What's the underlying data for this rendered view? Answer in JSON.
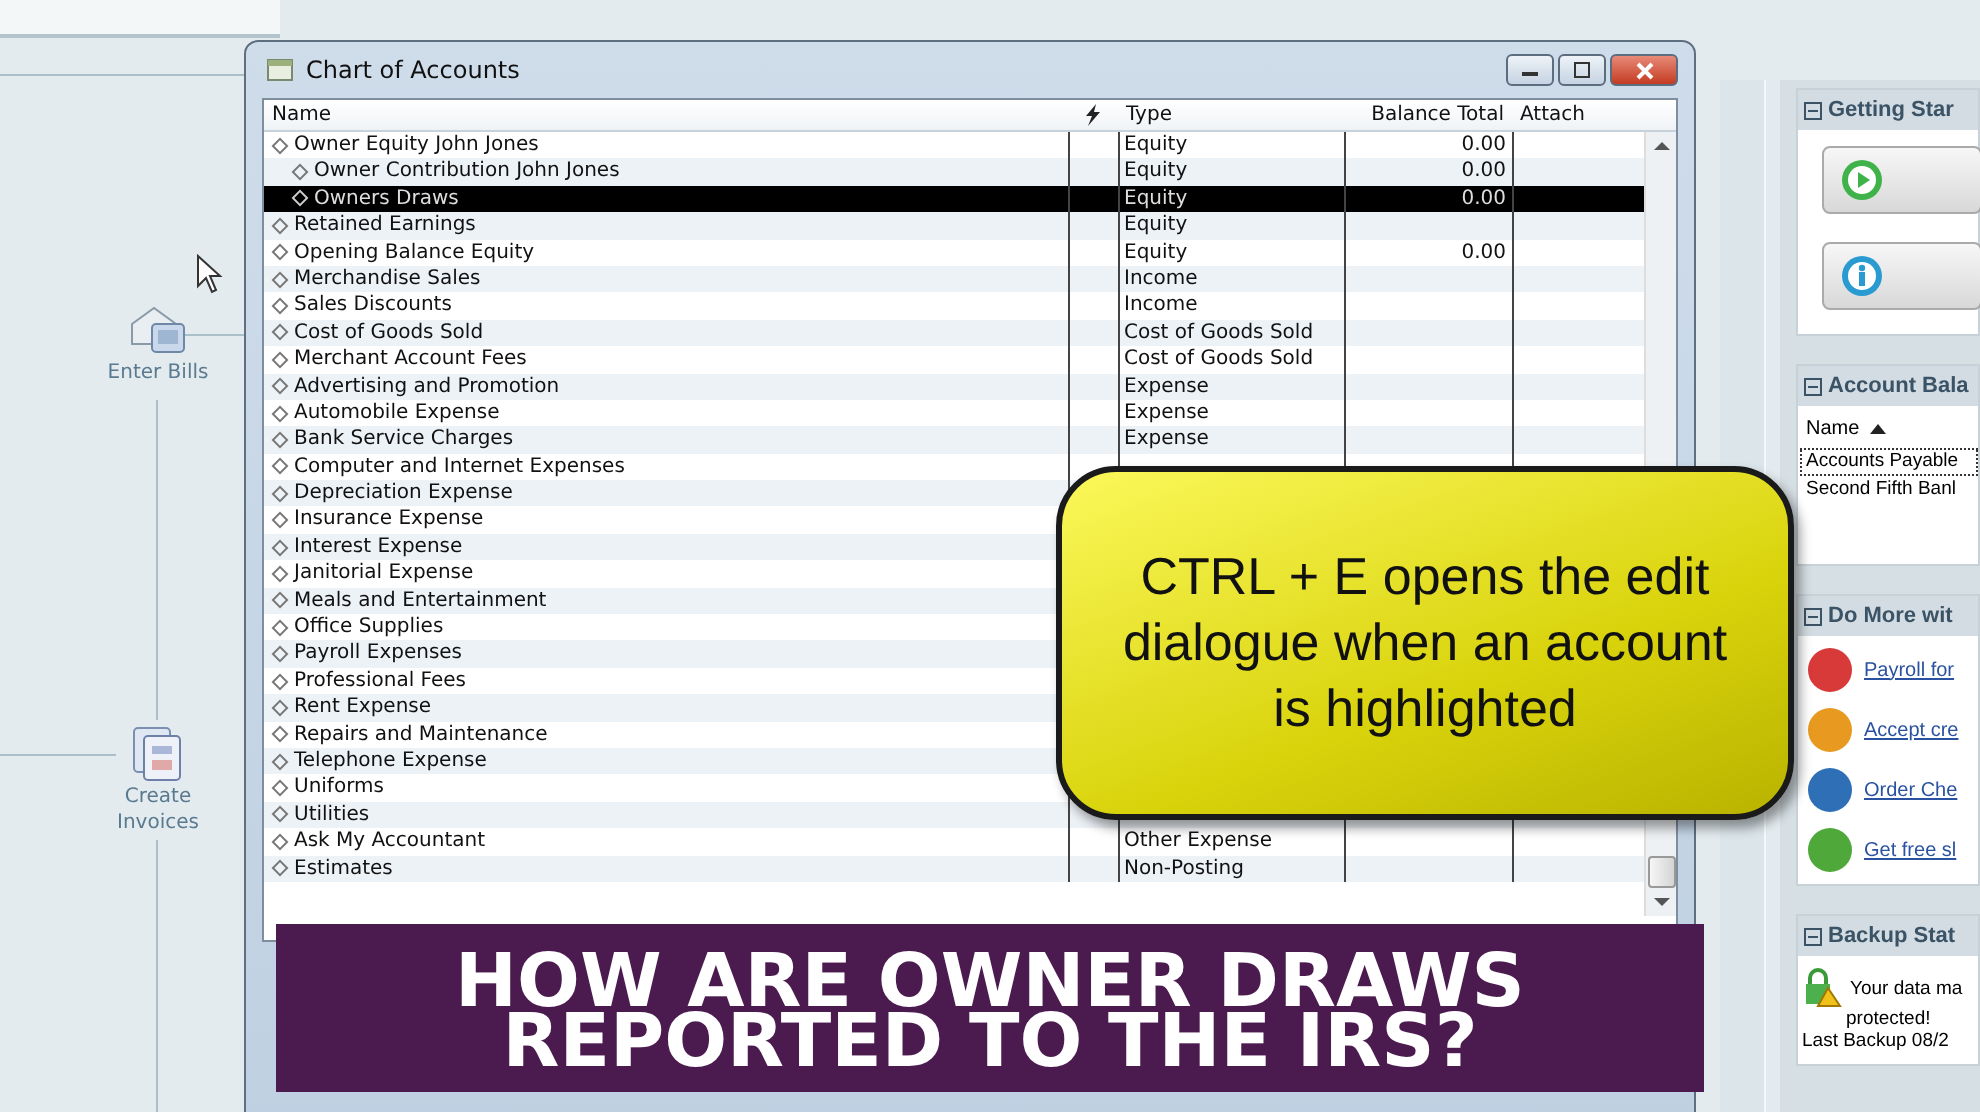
{
  "workflow": {
    "nodes": [
      {
        "label": "Enter Bills",
        "kind": "bills"
      },
      {
        "label": "Create Invoices",
        "kind": "invoices"
      }
    ]
  },
  "window": {
    "title": "Chart of Accounts",
    "columns": [
      "Name",
      "Type",
      "Balance Total",
      "Attach"
    ],
    "rows": [
      {
        "name": "Owner Equity John Jones",
        "type": "Equity",
        "balance": "0.00",
        "selected": false,
        "children": [
          {
            "name": "Owner Contribution John Jones",
            "type": "Equity",
            "balance": "0.00",
            "selected": false
          },
          {
            "name": "Owners Draws",
            "type": "Equity",
            "balance": "0.00",
            "selected": true
          }
        ]
      },
      {
        "name": "Retained Earnings",
        "type": "Equity",
        "selected": false
      },
      {
        "name": "Opening Balance Equity",
        "type": "Equity",
        "balance": "0.00",
        "selected": false
      },
      {
        "name": "Merchandise Sales",
        "type": "Income",
        "selected": false
      },
      {
        "name": "Sales Discounts",
        "type": "Income",
        "selected": false
      },
      {
        "name": "Cost of Goods Sold",
        "type": "Cost of Goods Sold",
        "selected": false
      },
      {
        "name": "Merchant Account Fees",
        "type": "Cost of Goods Sold",
        "selected": false
      },
      {
        "name": "Advertising and Promotion",
        "type": "Expense",
        "selected": false
      },
      {
        "name": "Automobile Expense",
        "type": "Expense",
        "selected": false
      },
      {
        "name": "Bank Service Charges",
        "type": "Expense",
        "selected": false
      },
      {
        "name": "Computer and Internet Expenses",
        "selected": false
      },
      {
        "name": "Depreciation Expense",
        "selected": false
      },
      {
        "name": "Insurance Expense",
        "selected": false
      },
      {
        "name": "Interest Expense",
        "selected": false
      },
      {
        "name": "Janitorial Expense",
        "selected": false
      },
      {
        "name": "Meals and Entertainment",
        "selected": false
      },
      {
        "name": "Office Supplies",
        "selected": false
      },
      {
        "name": "Payroll Expenses",
        "selected": false
      },
      {
        "name": "Professional Fees",
        "selected": false
      },
      {
        "name": "Rent Expense",
        "selected": false
      },
      {
        "name": "Repairs and Maintenance",
        "selected": false
      },
      {
        "name": "Telephone Expense",
        "selected": false
      },
      {
        "name": "Uniforms",
        "selected": false
      },
      {
        "name": "Utilities",
        "selected": false
      },
      {
        "name": "Ask My Accountant",
        "type": "Other Expense",
        "selected": false
      },
      {
        "name": "Estimates",
        "type": "Non-Posting",
        "selected": false
      }
    ]
  },
  "right_panel": {
    "sections": [
      {
        "kind": "buttons",
        "title": "Getting Star",
        "buttons": [
          {
            "kind": "play"
          },
          {
            "kind": "info"
          }
        ]
      },
      {
        "kind": "table",
        "title": "Account Bala",
        "column": "Name",
        "rows": [
          {
            "name": "Accounts Payable",
            "selected": true
          },
          {
            "name": "Second Fifth Banl",
            "selected": false
          }
        ]
      },
      {
        "kind": "links",
        "title": "Do More wit",
        "links": [
          {
            "label": "Payroll for",
            "color": "#d83a3a"
          },
          {
            "label": "Accept cre",
            "color": "#e89a20"
          },
          {
            "label": "Order Che",
            "color": "#2f6fb5"
          },
          {
            "label": "Get free sl",
            "color": "#4ea83a"
          }
        ]
      },
      {
        "kind": "backup",
        "title": "Backup Stat",
        "lines": [
          "Your data ma",
          "protected!",
          "Last Backup 08/2"
        ]
      }
    ]
  },
  "callout": {
    "text": "CTRL + E opens the edit dialogue when an account is highlighted"
  },
  "banner": {
    "lines": [
      "HOW ARE OWNER DRAWS",
      "REPORTED TO THE IRS?"
    ]
  }
}
